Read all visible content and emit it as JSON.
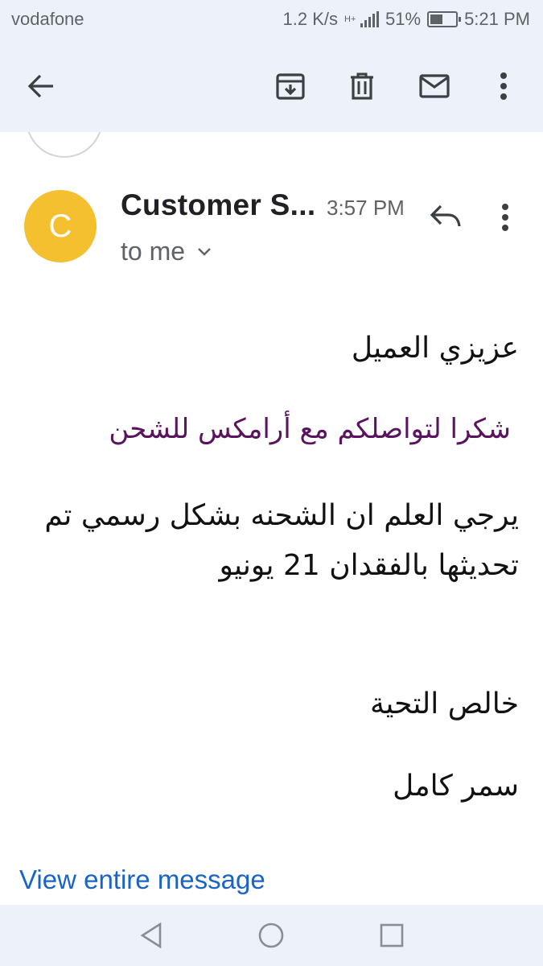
{
  "status_bar": {
    "carrier": "vodafone",
    "speed": "1.2 K/s",
    "network": "H+",
    "battery_percent": "51%",
    "battery_level": 0.51,
    "time": "5:21 PM"
  },
  "toolbar": {
    "back_icon": "arrow-back-icon",
    "archive_icon": "archive-icon",
    "delete_icon": "trash-icon",
    "mark_unread_icon": "mail-icon",
    "more_icon": "more-vert-icon"
  },
  "message": {
    "avatar_initial": "C",
    "avatar_color": "#f4c030",
    "sender": "Customer S...",
    "time": "3:57 PM",
    "recipient": "to me",
    "body": {
      "greeting": "عزيزي العميل",
      "thanks": "شكرا لتواصلكم مع أرامكس للشحن",
      "paragraph": "يرجي العلم ان الشحنه بشكل رسمي تم تحديثها بالفقدان 21 يونيو",
      "regards": "خالص التحية",
      "signature": "سمر كامل"
    },
    "view_entire": "View entire message"
  },
  "colors": {
    "accent": "#1a63c7",
    "toolbar_bg": "#edf2fa",
    "thanks_text": "#5a135e"
  }
}
